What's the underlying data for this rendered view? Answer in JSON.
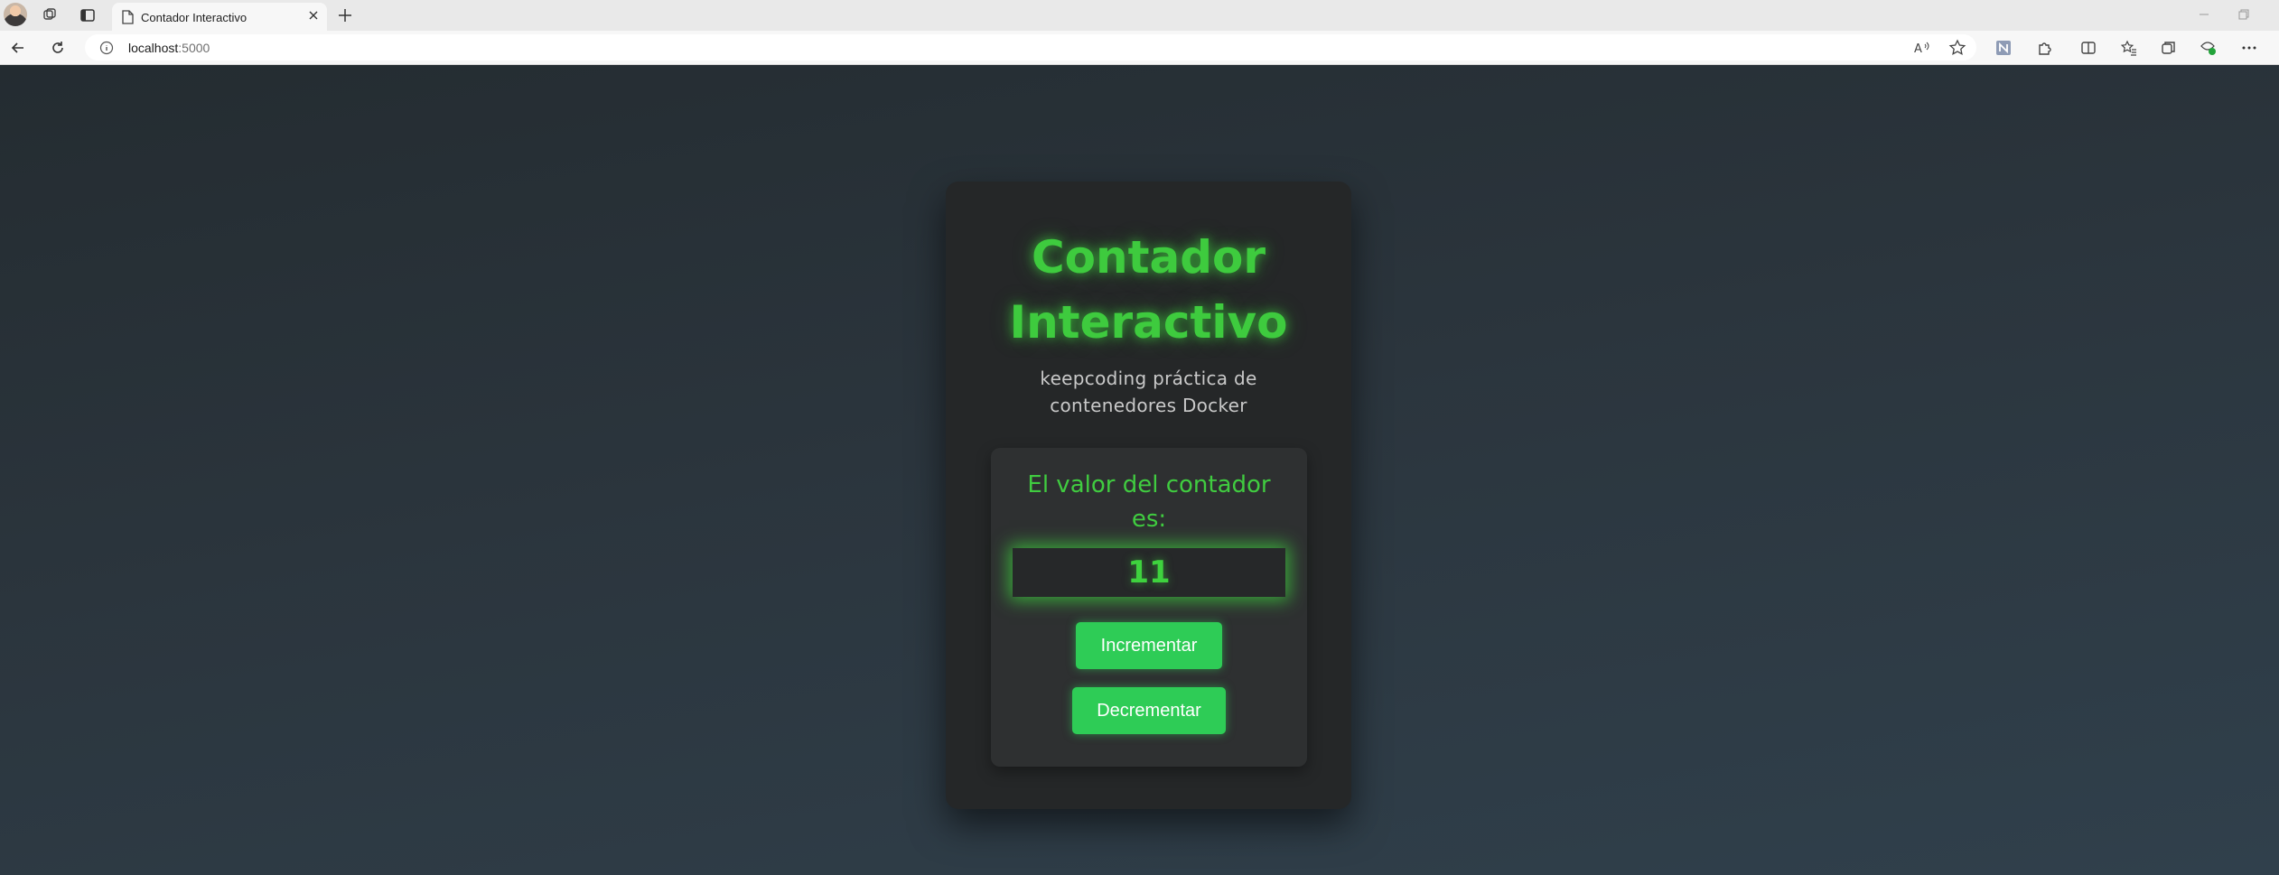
{
  "browser": {
    "tab_title": "Contador Interactivo",
    "url_host": "localhost",
    "url_port": ":5000"
  },
  "page": {
    "title_line1": "Contador",
    "title_line2": "Interactivo",
    "subtitle_line1": "keepcoding práctica de",
    "subtitle_line2": "contenedores Docker",
    "counter_label_line1": "El valor del contador",
    "counter_label_line2": "es:",
    "counter_value": "11",
    "increment_label": "Incrementar",
    "decrement_label": "Decrementar"
  },
  "colors": {
    "accent_green": "#3ecb3e",
    "button_green": "#2ecc56"
  }
}
